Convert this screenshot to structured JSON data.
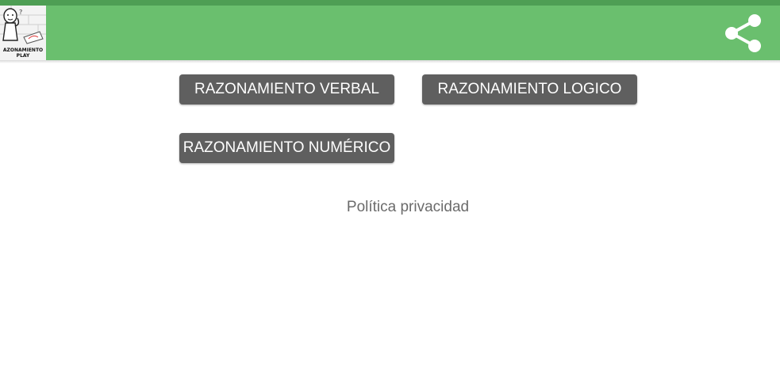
{
  "app": {
    "logo_text_line1": "AZONAMIENTO",
    "logo_text_line2": "PLAY",
    "share_icon": "share-icon",
    "colors": {
      "appbar": "#6abf6e",
      "statusbar": "#4e9e54",
      "button": "#5f5f5f"
    }
  },
  "menu": {
    "verbal_label": "RAZONAMIENTO VERBAL",
    "logico_label": "RAZONAMIENTO LOGICO",
    "numerico_label": "RAZONAMIENTO NUMÉRICO"
  },
  "footer": {
    "privacy_label": "Política privacidad"
  }
}
